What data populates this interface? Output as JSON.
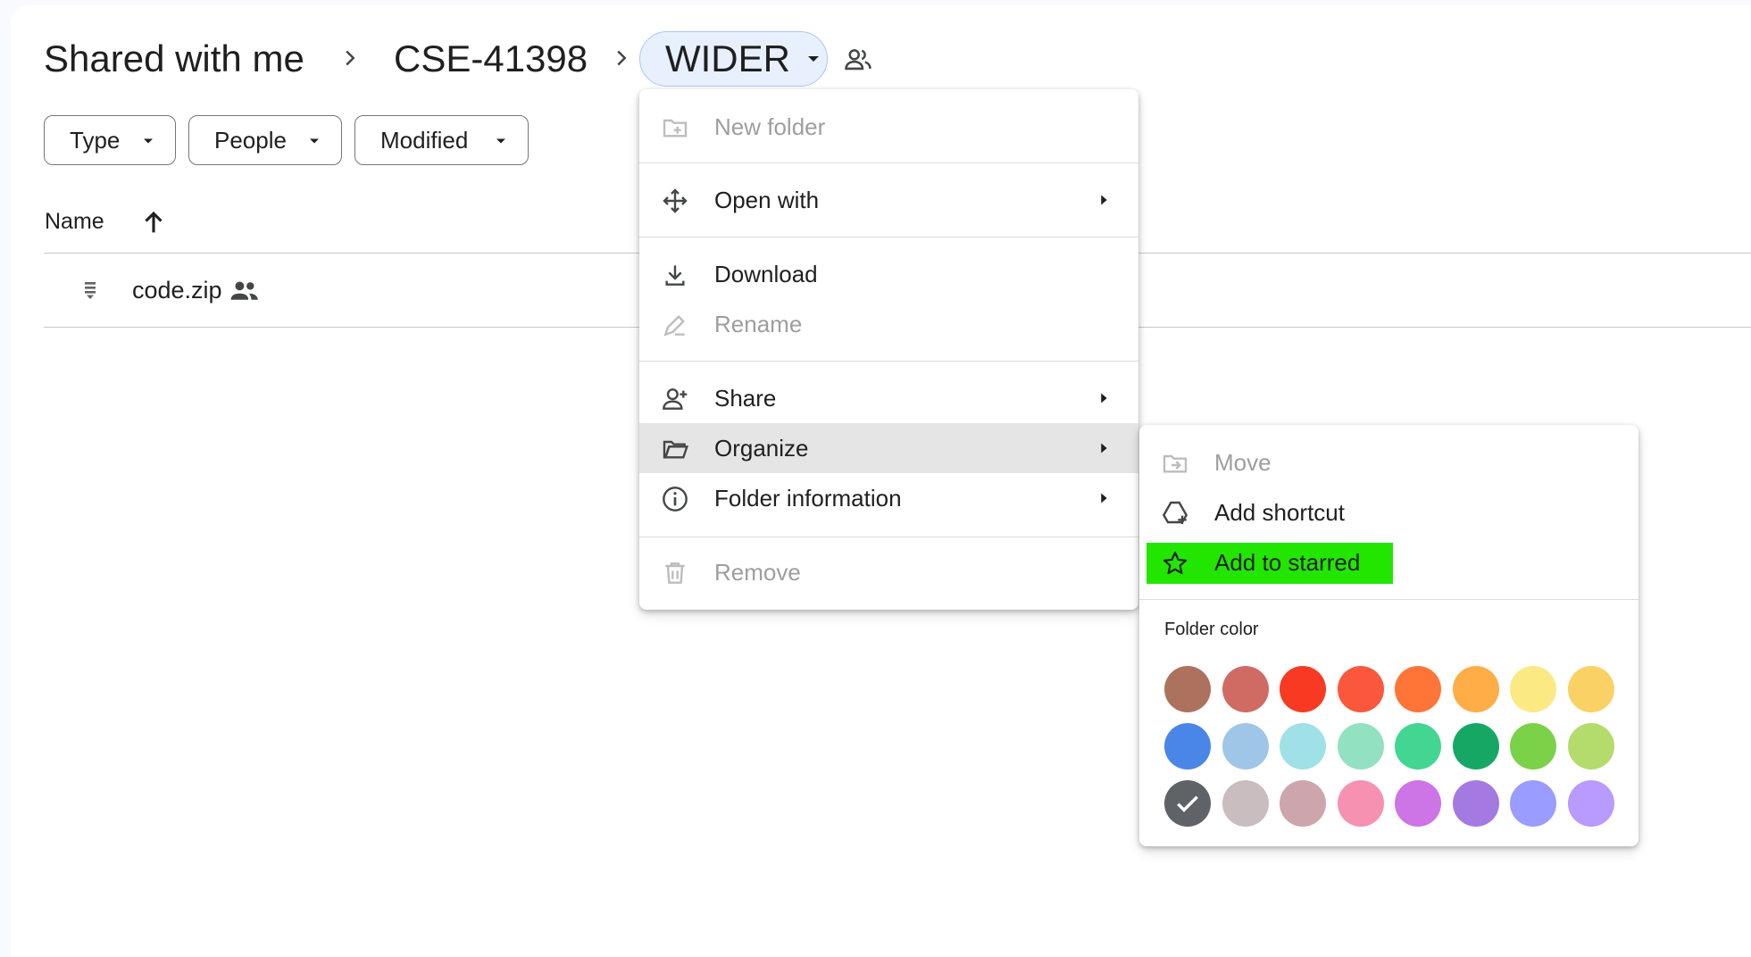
{
  "breadcrumb": {
    "root": "Shared with me",
    "parent": "CSE-41398",
    "current": "WIDER"
  },
  "filters": [
    {
      "label": "Type"
    },
    {
      "label": "People"
    },
    {
      "label": "Modified"
    }
  ],
  "list": {
    "column_name": "Name",
    "files": [
      {
        "name": "code.zip",
        "shared": true
      }
    ]
  },
  "context_menu": {
    "items": [
      {
        "label": "New folder",
        "icon": "new-folder-icon",
        "disabled": true
      },
      {
        "label": "Open with",
        "icon": "move-arrows-icon",
        "submenu": true
      },
      {
        "label": "Download",
        "icon": "download-icon"
      },
      {
        "label": "Rename",
        "icon": "rename-pencil-icon",
        "disabled": true
      },
      {
        "label": "Share",
        "icon": "person-add-icon",
        "submenu": true
      },
      {
        "label": "Organize",
        "icon": "folder-open-icon",
        "submenu": true,
        "active": true
      },
      {
        "label": "Folder information",
        "icon": "info-icon",
        "submenu": true
      },
      {
        "label": "Remove",
        "icon": "trash-icon",
        "disabled": true
      }
    ]
  },
  "organize_submenu": {
    "items": [
      {
        "label": "Move",
        "icon": "move-to-folder-icon",
        "disabled": true
      },
      {
        "label": "Add shortcut",
        "icon": "add-shortcut-icon"
      },
      {
        "label": "Add to starred",
        "icon": "star-outline-icon",
        "highlighted": true
      }
    ],
    "folder_color_title": "Folder color",
    "folder_colors": [
      "#ac725e",
      "#d06b64",
      "#f83a22",
      "#fa573c",
      "#ff7537",
      "#ffad46",
      "#fbe983",
      "#fad165",
      "#4986e7",
      "#9fc6e7",
      "#9fe1e7",
      "#92e1c0",
      "#42d692",
      "#16a765",
      "#7bd148",
      "#b3dc6c",
      "#5f6368",
      "#cabdbf",
      "#cca6ac",
      "#f691b2",
      "#cd74e6",
      "#a47ae2",
      "#9a9cff",
      "#b99aff"
    ],
    "selected_color": "#5f6368"
  },
  "colors": {
    "highlight": "#22e600",
    "chip_border": "#747775",
    "selected_breadcrumb_bg": "#e8f0fe"
  }
}
